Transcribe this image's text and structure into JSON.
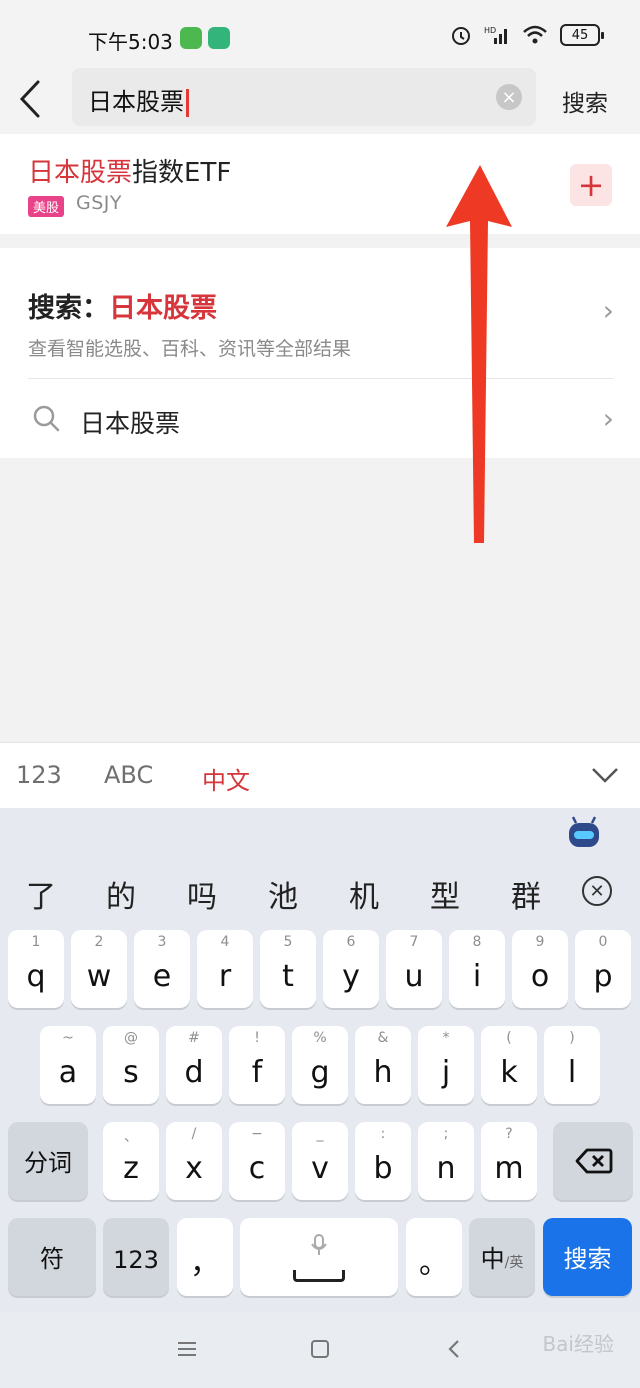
{
  "status_bar": {
    "time": "下午5:03",
    "battery": "45",
    "network": "HD"
  },
  "header": {
    "query": "日本股票",
    "search_label": "搜索"
  },
  "result": {
    "title_highlight": "日本股票",
    "title_rest": "指数ETF",
    "market_tag": "美股",
    "code": "GSJY",
    "add_symbol": "+"
  },
  "search_section": {
    "title_prefix": "搜索：",
    "title_query": "日本股票",
    "subtitle": "查看智能选股、百科、资讯等全部结果",
    "suggestion": "日本股票",
    "chevron": "›"
  },
  "keyboard_tabs": {
    "numbers": "123",
    "english": "ABC",
    "chinese": "中文"
  },
  "candidates": [
    "了",
    "的",
    "吗",
    "池",
    "机",
    "型",
    "群"
  ],
  "keyboard": {
    "row1": [
      {
        "key": "q",
        "sub": "1"
      },
      {
        "key": "w",
        "sub": "2"
      },
      {
        "key": "e",
        "sub": "3"
      },
      {
        "key": "r",
        "sub": "4"
      },
      {
        "key": "t",
        "sub": "5"
      },
      {
        "key": "y",
        "sub": "6"
      },
      {
        "key": "u",
        "sub": "7"
      },
      {
        "key": "i",
        "sub": "8"
      },
      {
        "key": "o",
        "sub": "9"
      },
      {
        "key": "p",
        "sub": "0"
      }
    ],
    "row2": [
      {
        "key": "a",
        "sub": "~"
      },
      {
        "key": "s",
        "sub": "@"
      },
      {
        "key": "d",
        "sub": "#"
      },
      {
        "key": "f",
        "sub": "!"
      },
      {
        "key": "g",
        "sub": "%"
      },
      {
        "key": "h",
        "sub": "&"
      },
      {
        "key": "j",
        "sub": "*"
      },
      {
        "key": "k",
        "sub": "("
      },
      {
        "key": "l",
        "sub": ")"
      }
    ],
    "row3": [
      {
        "key": "z",
        "sub": "、"
      },
      {
        "key": "x",
        "sub": "/"
      },
      {
        "key": "c",
        "sub": "−"
      },
      {
        "key": "v",
        "sub": "_"
      },
      {
        "key": "b",
        "sub": ":"
      },
      {
        "key": "n",
        "sub": ";"
      },
      {
        "key": "m",
        "sub": "?"
      }
    ],
    "segment_label": "分词",
    "symbol_label": "符",
    "number_label": "123",
    "comma": "，",
    "period": "。",
    "lang_main": "中",
    "lang_sub": "/英",
    "enter_label": "搜索"
  },
  "watermark": "Bai经验",
  "colors": {
    "accent": "#d6363b",
    "enter": "#1a73e8",
    "tag": "#e84388"
  }
}
